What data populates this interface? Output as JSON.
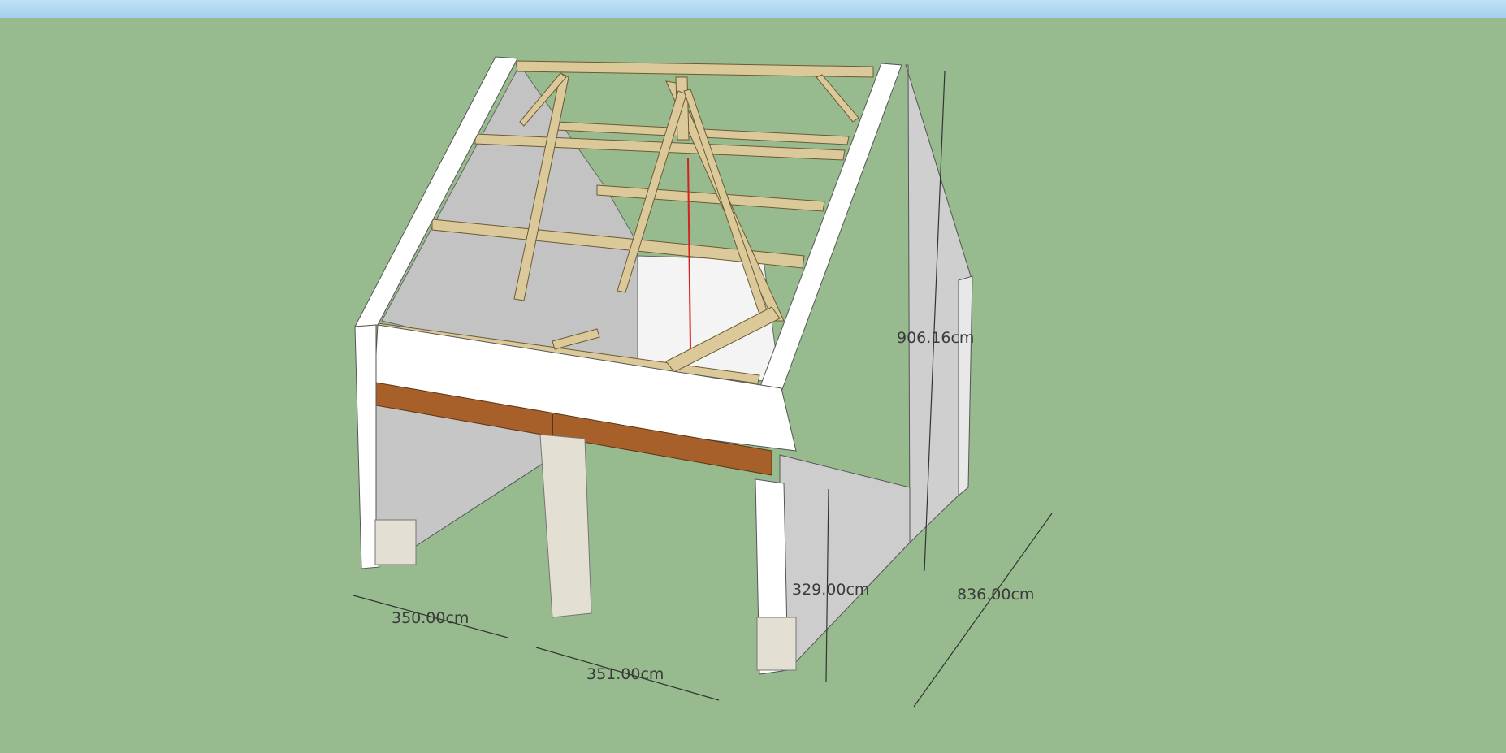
{
  "dimensions": {
    "height": "906.16cm",
    "depth": "836.00cm",
    "opening_height": "329.00cm",
    "bay_left_width": "350.00cm",
    "bay_right_width": "351.00cm"
  },
  "colors": {
    "ground": "#97bb8f",
    "sky": "#b3d8f1",
    "wall_face": "#ffffff",
    "wall_shadow": "#c4c4c4",
    "timber": "#dcc99a",
    "lintel": "#a8602a",
    "guide_line": "#d62020"
  }
}
